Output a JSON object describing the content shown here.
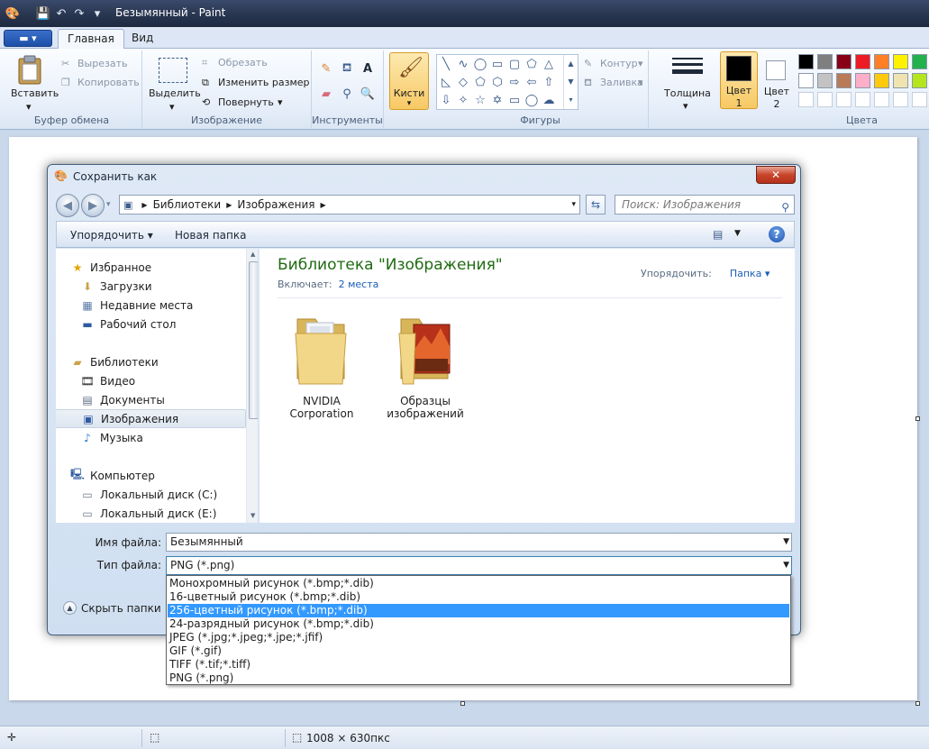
{
  "app": {
    "title": "Безымянный - Paint"
  },
  "ribbon": {
    "tabs": [
      "Главная",
      "Вид"
    ],
    "clipboard": {
      "paste": "Вставить",
      "cut": "Вырезать",
      "copy": "Копировать",
      "label": "Буфер обмена"
    },
    "image": {
      "select": "Выделить",
      "crop": "Обрезать",
      "resize": "Изменить размер",
      "rotate": "Повернуть",
      "label": "Изображение"
    },
    "tools": {
      "label": "Инструменты"
    },
    "brushes": {
      "label": "Кисти"
    },
    "shapes": {
      "outline": "Контур",
      "fill": "Заливка",
      "label": "Фигуры"
    },
    "size": {
      "label": "Толщина"
    },
    "color1": {
      "label": "Цвет",
      "num": "1"
    },
    "color2": {
      "label": "Цвет",
      "num": "2"
    },
    "colors": {
      "label": "Цвета",
      "row1": [
        "#000000",
        "#7f7f7f",
        "#880015",
        "#ed1c24",
        "#ff7f27",
        "#fff200",
        "#22b14c"
      ],
      "row2": [
        "#ffffff",
        "#c3c3c3",
        "#b97a57",
        "#ffaec9",
        "#ffc90e",
        "#efe4b0",
        "#b5e61d"
      ],
      "row3": [
        "#ffffff",
        "#ffffff",
        "#ffffff",
        "#ffffff",
        "#ffffff",
        "#ffffff",
        "#ffffff"
      ]
    }
  },
  "statusbar": {
    "dimensions": "1008 × 630пкс"
  },
  "dialog": {
    "title": "Сохранить как",
    "breadcrumb": [
      "Библиотеки",
      "Изображения"
    ],
    "search_placeholder": "Поиск: Изображения",
    "organize": "Упорядочить",
    "new_folder": "Новая папка",
    "nav": [
      {
        "label": "Избранное",
        "icon": "star-icon"
      },
      {
        "label": "Загрузки",
        "icon": "downloads-icon"
      },
      {
        "label": "Недавние места",
        "icon": "recent-places-icon"
      },
      {
        "label": "Рабочий стол",
        "icon": "desktop-icon"
      },
      {
        "label": "Библиотеки",
        "icon": "libraries-icon"
      },
      {
        "label": "Видео",
        "icon": "video-icon"
      },
      {
        "label": "Документы",
        "icon": "documents-icon"
      },
      {
        "label": "Изображения",
        "icon": "pictures-icon"
      },
      {
        "label": "Музыка",
        "icon": "music-icon"
      },
      {
        "label": "Компьютер",
        "icon": "computer-icon"
      },
      {
        "label": "Локальный диск (C:)",
        "icon": "drive-c-icon"
      },
      {
        "label": "Локальный диск (E:)",
        "icon": "drive-e-icon"
      }
    ],
    "library_title": "Библиотека \"Изображения\"",
    "includes_label": "Включает:",
    "includes_link": "2 места",
    "arrange_label": "Упорядочить:",
    "arrange_value": "Папка",
    "folders": [
      {
        "name_line1": "NVIDIA",
        "name_line2": "Corporation"
      },
      {
        "name_line1": "Образцы",
        "name_line2": "изображений"
      }
    ],
    "filename_label": "Имя файла:",
    "filename_value": "Безымянный",
    "filetype_label": "Тип файла:",
    "filetype_value": "PNG (*.png)",
    "hide_folders": "Скрыть папки",
    "filetype_options": [
      "Монохромный рисунок (*.bmp;*.dib)",
      "16-цветный рисунок (*.bmp;*.dib)",
      "256-цветный рисунок (*.bmp;*.dib)",
      "24-разрядный рисунок (*.bmp;*.dib)",
      "JPEG (*.jpg;*.jpeg;*.jpe;*.jfif)",
      "GIF (*.gif)",
      "TIFF (*.tif;*.tiff)",
      "PNG (*.png)"
    ],
    "highlighted_option": "256-цветный рисунок (*.bmp;*.dib)"
  }
}
